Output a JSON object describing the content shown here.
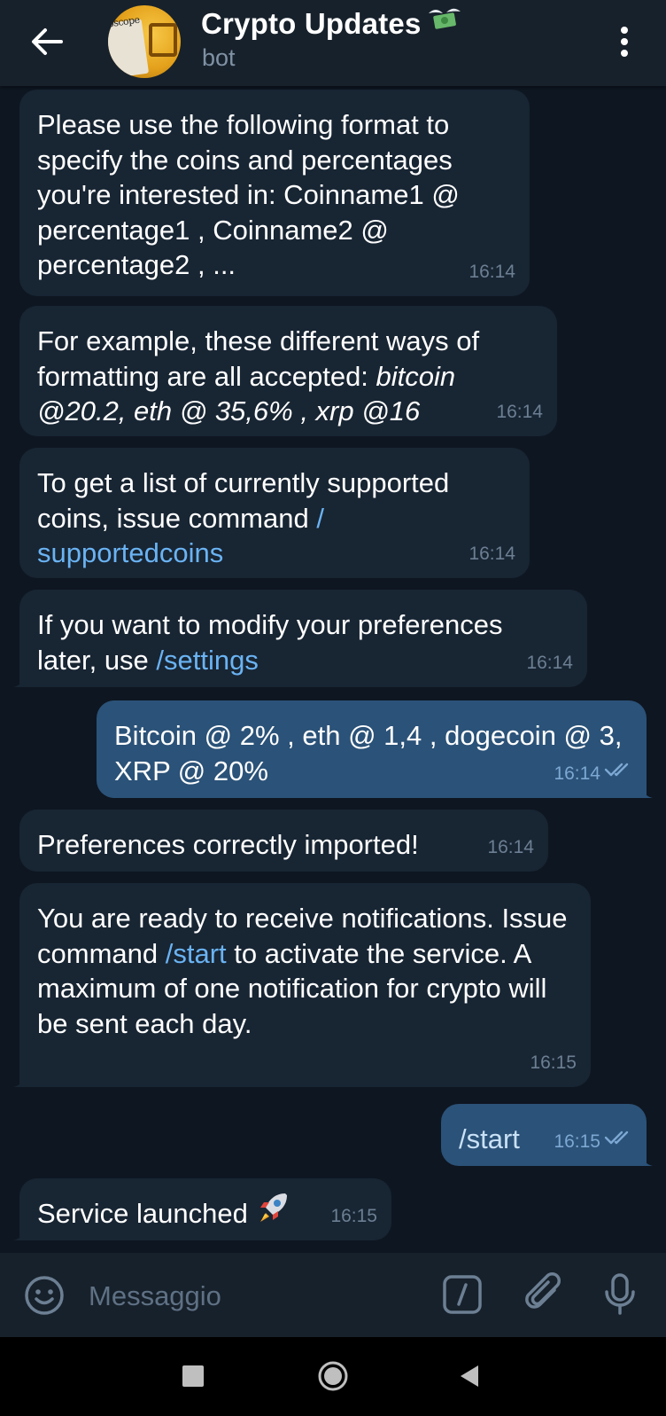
{
  "header": {
    "title": "Crypto Updates",
    "title_emoji": "money-with-wings-icon",
    "subtitle": "bot",
    "avatar_text": "oscope"
  },
  "messages": [
    {
      "direction": "incoming",
      "text": "Please use the following format to specify the coins and percentages you're interested in: Coinname1 @ percentage1 , Coinname2 @ percentage2 , ...",
      "time": "16:14"
    },
    {
      "direction": "incoming",
      "text_prefix": "For example, these different ways of formatting are all accepted: ",
      "text_italic": "bitcoin @20.2, eth @ 35,6% , xrp @16",
      "time": "16:14"
    },
    {
      "direction": "incoming",
      "text_prefix": "To get a list of currently supported coins, issue command ",
      "link_part1": "/",
      "link_part2": "supportedcoins",
      "time": "16:14"
    },
    {
      "direction": "incoming",
      "text_prefix": "If you want to modify your preferences later, use ",
      "link": "/settings",
      "time": "16:14"
    },
    {
      "direction": "outgoing",
      "text": "Bitcoin @ 2% , eth @ 1,4 , dogecoin @ 3, XRP @ 20%",
      "time": "16:14",
      "status": "read"
    },
    {
      "direction": "incoming",
      "text": "Preferences correctly imported!",
      "time": "16:14"
    },
    {
      "direction": "incoming",
      "text_prefix": "You are ready to receive notifications. Issue command ",
      "link": "/start",
      "text_suffix": " to activate the service. A maximum of one notification for crypto will be sent each day.",
      "time": "16:15"
    },
    {
      "direction": "outgoing",
      "text": "/start",
      "time": "16:15",
      "status": "read"
    },
    {
      "direction": "incoming",
      "text": "Service launched",
      "emoji": "rocket-icon",
      "time": "16:15"
    }
  ],
  "composer": {
    "placeholder": "Messaggio",
    "value": ""
  },
  "colors": {
    "background": "#0e1621",
    "header": "#17212b",
    "incoming_bubble": "#182533",
    "outgoing_bubble": "#2b5278",
    "link": "#6ab3f3",
    "time_incoming": "#6c7f93",
    "time_outgoing": "#7da8d3"
  }
}
